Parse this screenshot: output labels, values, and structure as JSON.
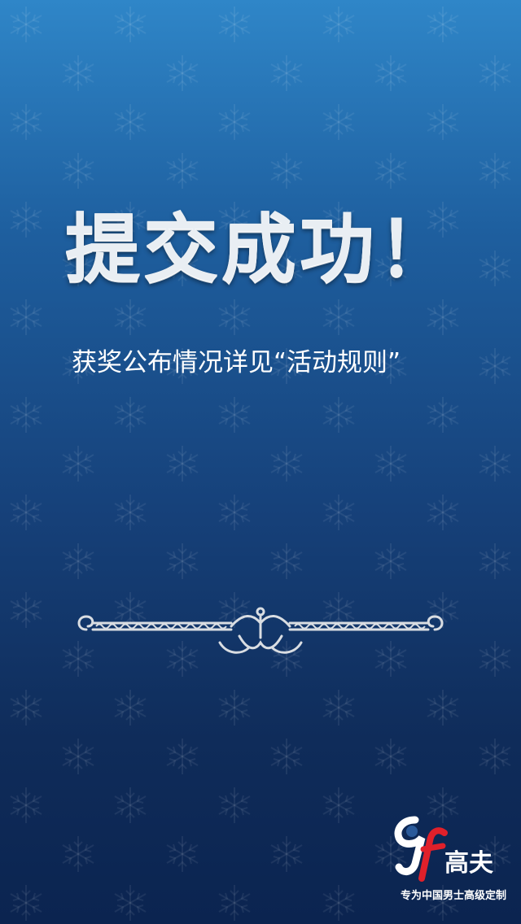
{
  "main": {
    "title": "提交成功！",
    "message": "获奖公布情况详见“活动规则”"
  },
  "icons": {
    "background": "snowflake-pattern",
    "divider": "ornamental-divider"
  },
  "brand": {
    "logo_mark": "gf",
    "name": "高夫",
    "tagline": "专为中国男士高级定制"
  },
  "colors": {
    "background_top": "#2f86c8",
    "background_bottom": "#0b2450",
    "title": "#e9eef3",
    "text": "#ffffff",
    "logo_accent": "#e0202a"
  }
}
